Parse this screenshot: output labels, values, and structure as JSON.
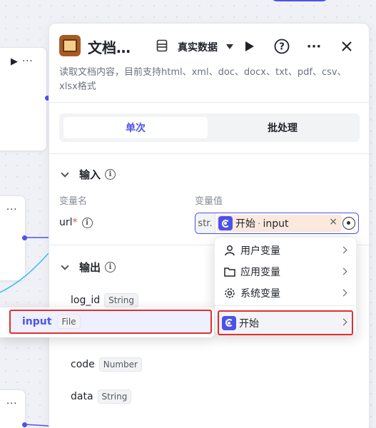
{
  "panel": {
    "title": "文档…",
    "data_source": "真实数据",
    "description": "读取文档内容，目前支持html、xml、doc、docx、txt、pdf、csv、xlsx格式",
    "header_icons": [
      "database-icon",
      "play-icon",
      "help-icon",
      "more-icon",
      "close-icon"
    ]
  },
  "tabs": [
    {
      "label": "单次",
      "active": true
    },
    {
      "label": "批处理",
      "active": false
    }
  ],
  "input_section": {
    "title": "输入",
    "col_name": "变量名",
    "col_value": "变量值",
    "var_name": "url",
    "required_mark": "*",
    "type_prefix": "str.",
    "ref_node": "开始",
    "ref_sep": "·",
    "ref_var": "input",
    "clear": "×"
  },
  "output_section": {
    "title": "输出",
    "fields": [
      {
        "name": "log_id",
        "type": "String"
      },
      {
        "name": "code",
        "type": "Number"
      },
      {
        "name": "data",
        "type": "String"
      }
    ]
  },
  "var_menu": {
    "items": [
      {
        "label": "用户变量",
        "icon": "user-icon"
      },
      {
        "label": "应用变量",
        "icon": "folder-icon"
      },
      {
        "label": "系统变量",
        "icon": "gear-icon"
      },
      {
        "label": "开始",
        "icon": "start-node-icon"
      }
    ]
  },
  "submenu": {
    "name": "input",
    "type": "File"
  },
  "colors": {
    "accent": "#4d53e8",
    "highlight": "#e52e2e",
    "chip_bg": "#fbe9de"
  }
}
